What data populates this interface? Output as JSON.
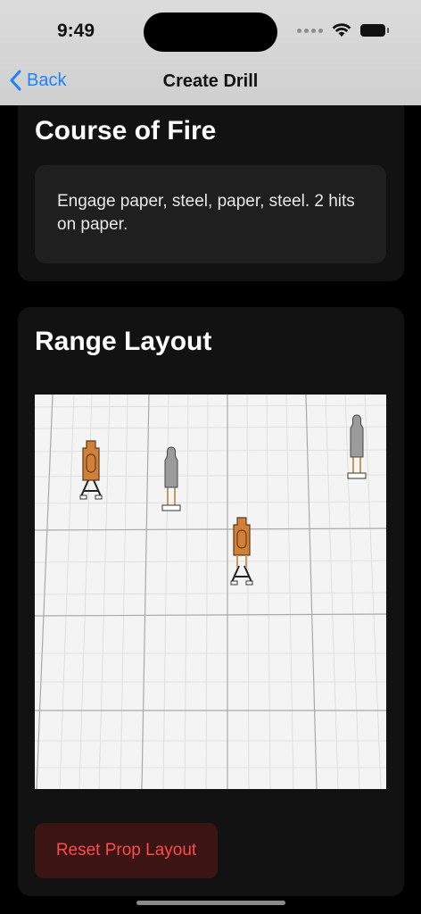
{
  "status_bar": {
    "time": "9:49"
  },
  "nav": {
    "back_label": "Back",
    "title": "Create Drill"
  },
  "course_of_fire": {
    "title": "Course of Fire",
    "description": "Engage paper, steel, paper, steel. 2 hits on paper."
  },
  "range_layout": {
    "title": "Range Layout",
    "reset_label": "Reset Prop Layout",
    "props": [
      {
        "kind": "paper"
      },
      {
        "kind": "steel"
      },
      {
        "kind": "paper"
      },
      {
        "kind": "steel"
      }
    ]
  },
  "colors": {
    "accent_blue": "#1a84ff",
    "paper_target": "#d1803a",
    "steel_target": "#9b9b9b",
    "reset_text": "#ff4a4a",
    "reset_bg": "#3b1414"
  }
}
